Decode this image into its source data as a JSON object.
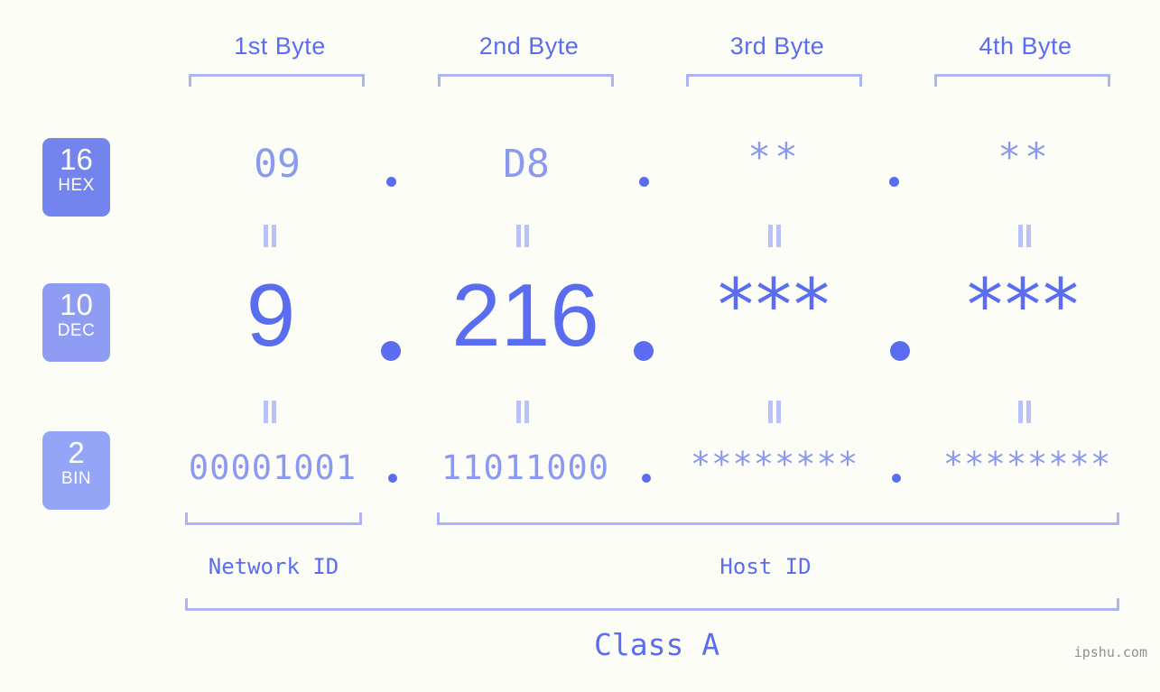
{
  "background_color": "#fdfdf7",
  "accent_color": "#5a6cf0",
  "accent_light_color": "#8b99f0",
  "bracket_color": "#aab4f7",
  "byte_headers": [
    {
      "label": "1st Byte"
    },
    {
      "label": "2nd Byte"
    },
    {
      "label": "3rd Byte"
    },
    {
      "label": "4th Byte"
    }
  ],
  "radix_badges": [
    {
      "number": "16",
      "unit": "HEX",
      "color": "#7484ee"
    },
    {
      "number": "10",
      "unit": "DEC",
      "color": "#8e9cf4"
    },
    {
      "number": "2",
      "unit": "BIN",
      "color": "#94a5f7"
    }
  ],
  "rows": {
    "hex": {
      "byte1": "09",
      "byte2": "D8",
      "byte3": "**",
      "byte4": "**"
    },
    "dec": {
      "byte1": "9",
      "byte2": "216",
      "byte3": "***",
      "byte4": "***"
    },
    "bin": {
      "byte1": "00001001",
      "byte2": "11011000",
      "byte3": "********",
      "byte4": "********"
    }
  },
  "separator": ".",
  "equals_symbol": "=",
  "id_labels": {
    "network": "Network ID",
    "host": "Host ID"
  },
  "class_label": "Class A",
  "watermark": "ipshu.com"
}
